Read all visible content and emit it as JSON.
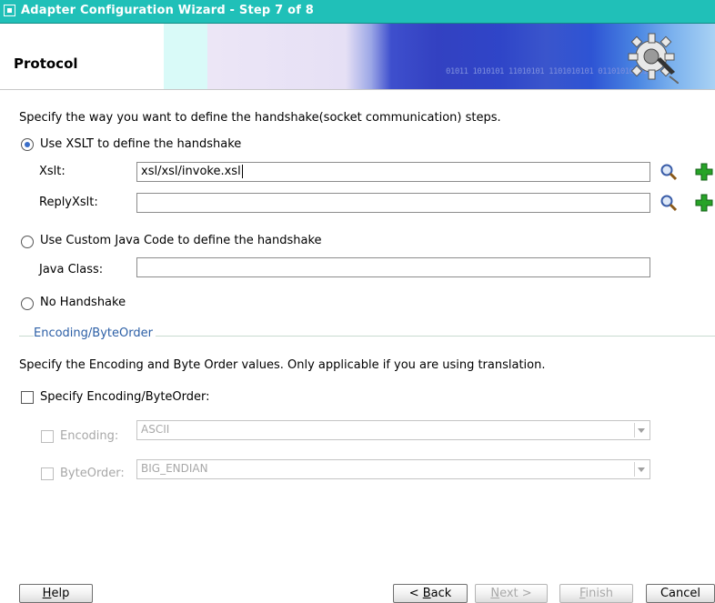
{
  "window": {
    "title": "Adapter Configuration Wizard - Step 7 of 8"
  },
  "header": {
    "page_title": "Protocol",
    "banner_bits": "01011  1010101  11010101  1101010101  01101010101"
  },
  "handshake": {
    "instruction": "Specify the way you want to define the handshake(socket communication) steps.",
    "selected_option": "xslt",
    "xslt_option": {
      "label": "Use XSLT to define the handshake",
      "xslt_label": "Xslt:",
      "xslt_value": "xsl/xsl/invoke.xsl",
      "reply_label": "ReplyXslt:",
      "reply_value": ""
    },
    "java_option": {
      "label": "Use Custom Java Code to define the handshake",
      "class_label": "Java Class:",
      "class_value": ""
    },
    "none_option": {
      "label": "No Handshake"
    }
  },
  "encoding": {
    "group_title": "Encoding/ByteOrder",
    "instruction": "Specify the Encoding and Byte Order values. Only applicable if you are using translation.",
    "specify_label": "Specify Encoding/ByteOrder:",
    "specify_checked": false,
    "encoding_label": "Encoding:",
    "encoding_value": "ASCII",
    "byteorder_label": "ByteOrder:",
    "byteorder_value": "BIG_ENDIAN"
  },
  "buttons": {
    "help": {
      "mnemonic": "H",
      "rest": "elp"
    },
    "back": {
      "prefix": "< ",
      "mnemonic": "B",
      "rest": "ack"
    },
    "next": {
      "mnemonic": "N",
      "rest": "ext >"
    },
    "finish": {
      "mnemonic": "F",
      "rest": "inish"
    },
    "cancel": "Cancel"
  },
  "colors": {
    "titlebar": "#20c0b8",
    "accent": "#2c5fa6",
    "add_icon": "#27a327"
  }
}
